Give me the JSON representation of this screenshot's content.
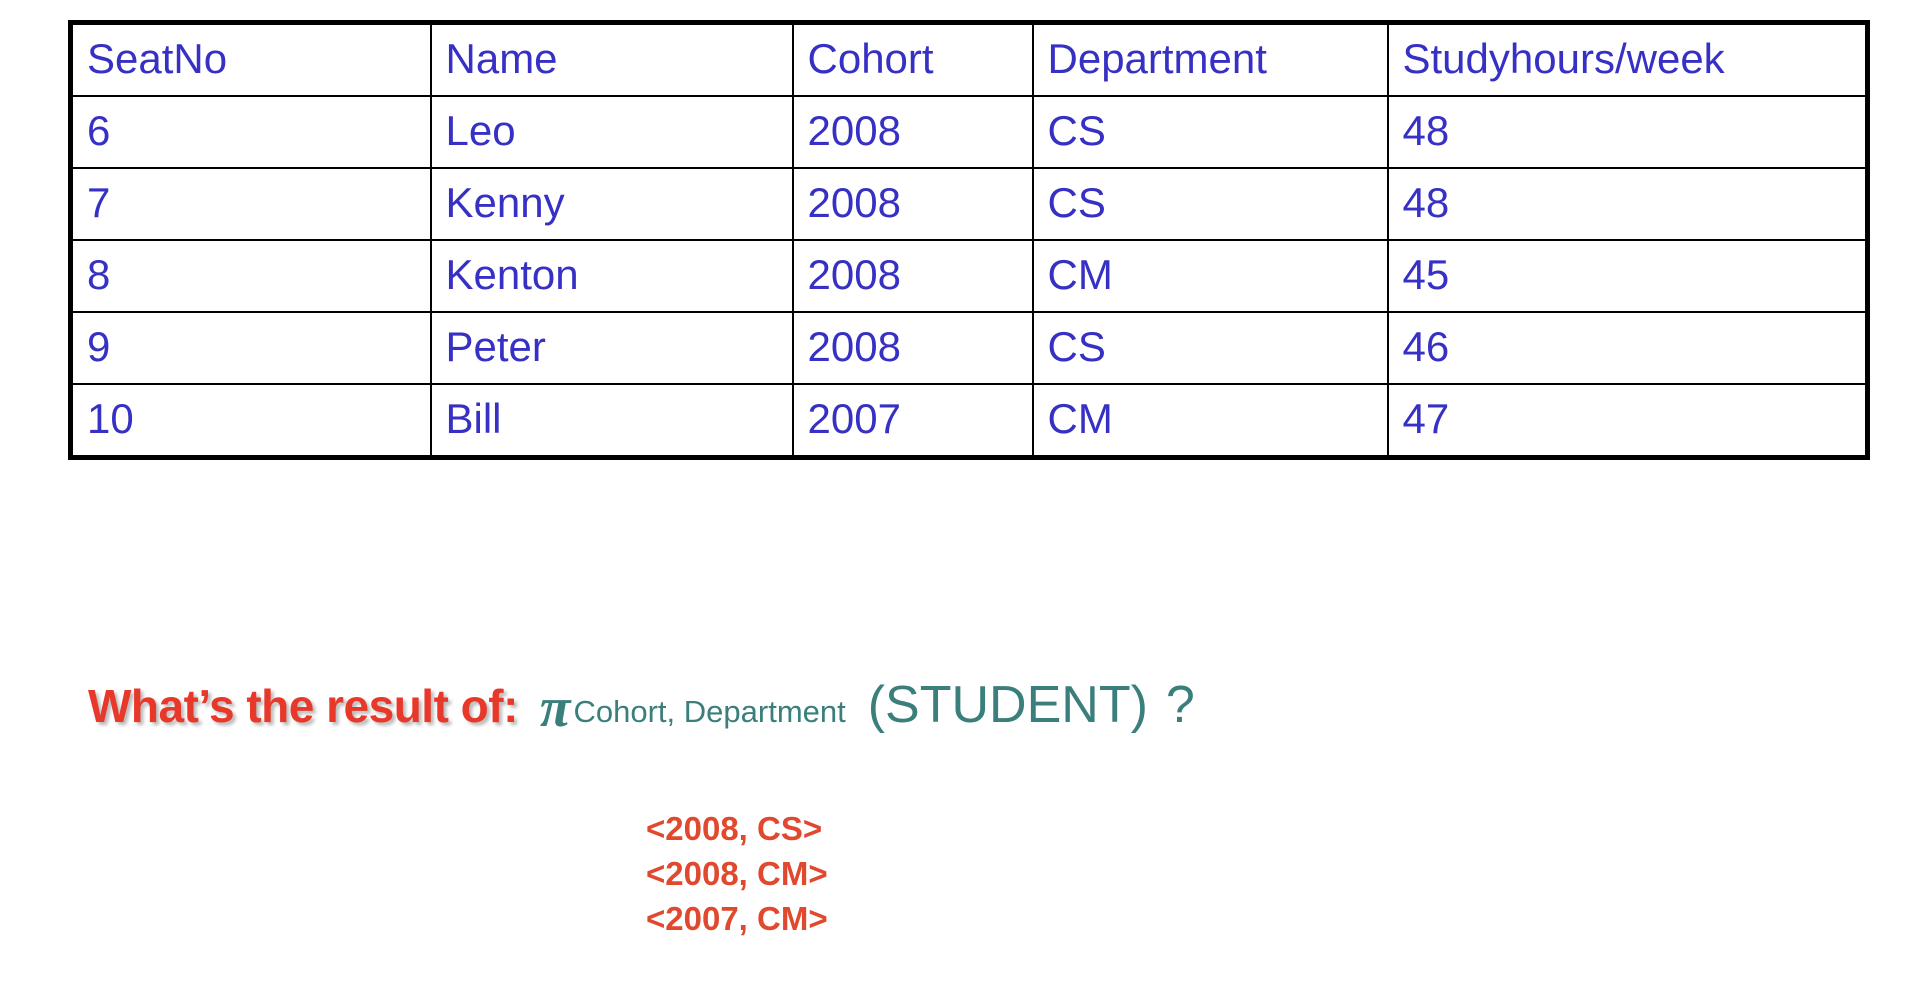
{
  "table": {
    "headers": [
      "SeatNo",
      "Name",
      "Cohort",
      "Department",
      "Studyhours/week"
    ],
    "rows": [
      [
        "6",
        "Leo",
        "2008",
        "CS",
        "48"
      ],
      [
        "7",
        "Kenny",
        "2008",
        "CS",
        "48"
      ],
      [
        "8",
        "Kenton",
        "2008",
        "CM",
        "45"
      ],
      [
        "9",
        "Peter",
        "2008",
        "CS",
        "46"
      ],
      [
        "10",
        "Bill",
        "2007",
        "CM",
        "47"
      ]
    ],
    "text_color": "#3730c4",
    "border_color": "#000000"
  },
  "question": {
    "prompt": "What’s the result of:",
    "operator_symbol": "π",
    "operator_subscript": "Cohort, Department",
    "relation": "(STUDENT)",
    "question_mark": "?",
    "prompt_color": "#e8382a",
    "expression_color": "#3a7f7b"
  },
  "answer": {
    "lines": [
      "<2008, CS>",
      "<2008, CM>",
      "<2007, CM>"
    ],
    "color": "#e0492e"
  }
}
